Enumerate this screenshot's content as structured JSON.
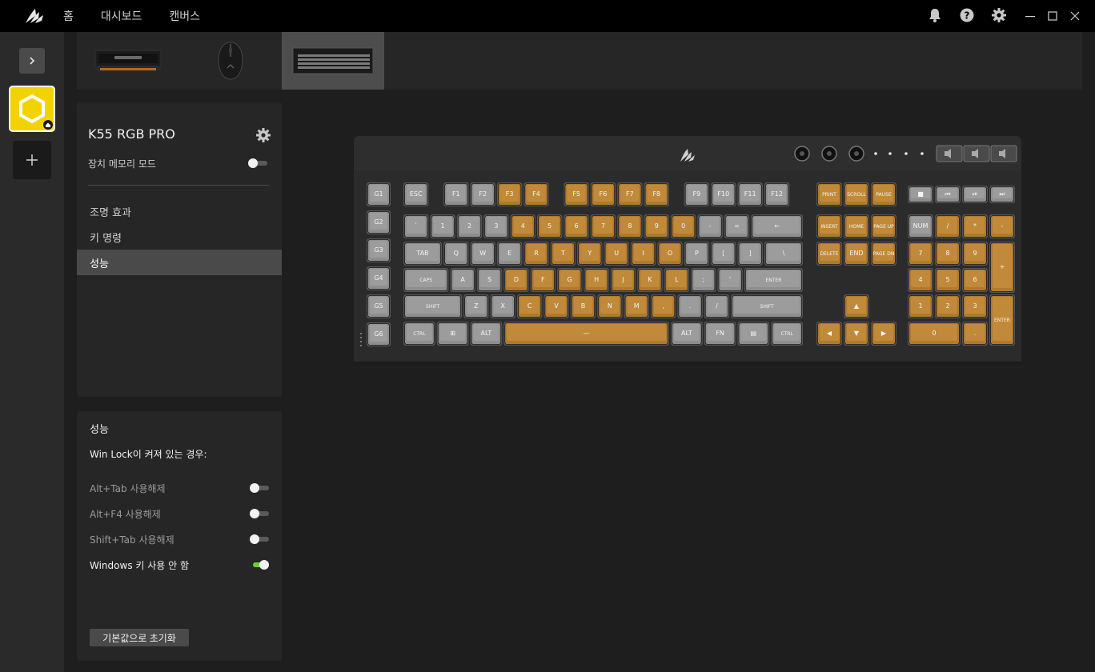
{
  "nav": {
    "home": "홈",
    "dashboard": "대시보드",
    "canvas": "캔버스"
  },
  "device": {
    "name": "K55 RGB PRO",
    "memory_mode_label": "장치 메모리 모드",
    "memory_mode_on": false
  },
  "menu": [
    {
      "label": "조명 효과",
      "active": false
    },
    {
      "label": "키 명령",
      "active": false
    },
    {
      "label": "성능",
      "active": true
    }
  ],
  "performance": {
    "title": "성능",
    "subtitle": "Win Lock이 켜져 있는 경우:",
    "options": [
      {
        "label": "Alt+Tab 사용해제",
        "on": false
      },
      {
        "label": "Alt+F4 사용해제",
        "on": false
      },
      {
        "label": "Shift+Tab 사용해제",
        "on": false
      },
      {
        "label": "Windows 키 사용 안 함",
        "on": true
      }
    ],
    "reset_label": "기본값으로 초기화"
  },
  "keyboard": {
    "gkeys": [
      "G1",
      "G2",
      "G3",
      "G4",
      "G5",
      "G6"
    ],
    "rows": [
      [
        [
          "ESC",
          1,
          0
        ],
        null,
        [
          "F1",
          1,
          0
        ],
        [
          "F2",
          1,
          0
        ],
        [
          "F3",
          1,
          1
        ],
        [
          "F4",
          1,
          1
        ],
        null,
        [
          "F5",
          1,
          1
        ],
        [
          "F6",
          1,
          1
        ],
        [
          "F7",
          1,
          1
        ],
        [
          "F8",
          1,
          1
        ],
        null,
        [
          "F9",
          1,
          0
        ],
        [
          "F10",
          1,
          0
        ],
        [
          "F11",
          1,
          0
        ],
        [
          "F12",
          1,
          0
        ]
      ],
      [
        [
          "`",
          1,
          0
        ],
        [
          "1",
          1,
          0
        ],
        [
          "2",
          1,
          0
        ],
        [
          "3",
          1,
          0
        ],
        [
          "4",
          1,
          1
        ],
        [
          "5",
          1,
          1
        ],
        [
          "6",
          1,
          1
        ],
        [
          "7",
          1,
          1
        ],
        [
          "8",
          1,
          1
        ],
        [
          "9",
          1,
          1
        ],
        [
          "0",
          1,
          1
        ],
        [
          "-",
          1,
          0
        ],
        [
          "=",
          1,
          0
        ],
        [
          "←",
          2,
          0
        ]
      ],
      [
        [
          "TAB",
          1.5,
          0
        ],
        [
          "Q",
          1,
          0
        ],
        [
          "W",
          1,
          0
        ],
        [
          "E",
          1,
          0
        ],
        [
          "R",
          1,
          1
        ],
        [
          "T",
          1,
          1
        ],
        [
          "Y",
          1,
          1
        ],
        [
          "U",
          1,
          1
        ],
        [
          "I",
          1,
          1
        ],
        [
          "O",
          1,
          1
        ],
        [
          "P",
          1,
          0
        ],
        [
          "[",
          1,
          0
        ],
        [
          "]",
          1,
          0
        ],
        [
          "\\",
          1.5,
          0
        ]
      ],
      [
        [
          "CAPS",
          1.75,
          0
        ],
        [
          "A",
          1,
          0
        ],
        [
          "S",
          1,
          0
        ],
        [
          "D",
          1,
          1
        ],
        [
          "F",
          1,
          1
        ],
        [
          "G",
          1,
          1
        ],
        [
          "H",
          1,
          1
        ],
        [
          "J",
          1,
          1
        ],
        [
          "K",
          1,
          1
        ],
        [
          "L",
          1,
          1
        ],
        [
          ";",
          1,
          0
        ],
        [
          "'",
          1,
          0
        ],
        [
          "ENTER",
          2.25,
          0
        ]
      ],
      [
        [
          "SHIFT",
          2.25,
          0
        ],
        [
          "Z",
          1,
          0
        ],
        [
          "X",
          1,
          0
        ],
        [
          "C",
          1,
          1
        ],
        [
          "V",
          1,
          1
        ],
        [
          "B",
          1,
          1
        ],
        [
          "N",
          1,
          1
        ],
        [
          "M",
          1,
          1
        ],
        [
          ",",
          1,
          1
        ],
        [
          ".",
          1,
          0
        ],
        [
          "/",
          1,
          0
        ],
        [
          "SHIFT",
          2.75,
          0
        ]
      ],
      [
        [
          "CTRL",
          1.25,
          0
        ],
        [
          "⊞",
          1.25,
          0
        ],
        [
          "ALT",
          1.25,
          0
        ],
        [
          "—",
          6.25,
          1
        ],
        [
          "ALT",
          1.25,
          0
        ],
        [
          "FN",
          1.25,
          0
        ],
        [
          "▤",
          1.25,
          0
        ],
        [
          "CTRL",
          1.25,
          0
        ]
      ]
    ],
    "nav_keys": [
      [
        "PRINT",
        "SCROLL",
        "PAUSE"
      ],
      [
        "INSERT",
        "HOME",
        "PAGE UP"
      ],
      [
        "DELETE",
        "END",
        "PAGE DN"
      ]
    ],
    "arrows": [
      "▲",
      "◀",
      "▼",
      "▶"
    ],
    "media": [
      "■",
      "⏮",
      "⏯",
      "⏭"
    ],
    "numpad": [
      [
        [
          "NUM",
          0
        ],
        [
          "/",
          1
        ],
        [
          "*",
          1
        ],
        [
          "-",
          1
        ]
      ],
      [
        [
          "7",
          1
        ],
        [
          "8",
          1
        ],
        [
          "9",
          1
        ],
        [
          "+",
          1
        ]
      ],
      [
        [
          "4",
          1
        ],
        [
          "5",
          1
        ],
        [
          "6",
          1
        ]
      ],
      [
        [
          "1",
          1
        ],
        [
          "2",
          1
        ],
        [
          "3",
          1
        ],
        [
          "ENTER",
          1
        ]
      ],
      [
        [
          "0",
          1
        ],
        [
          ".",
          1
        ]
      ]
    ],
    "colors": {
      "lit": "#b07a2e",
      "unlit": "#8e8e8e",
      "body": "#2b2b2b",
      "accent": "#f2d300"
    }
  }
}
